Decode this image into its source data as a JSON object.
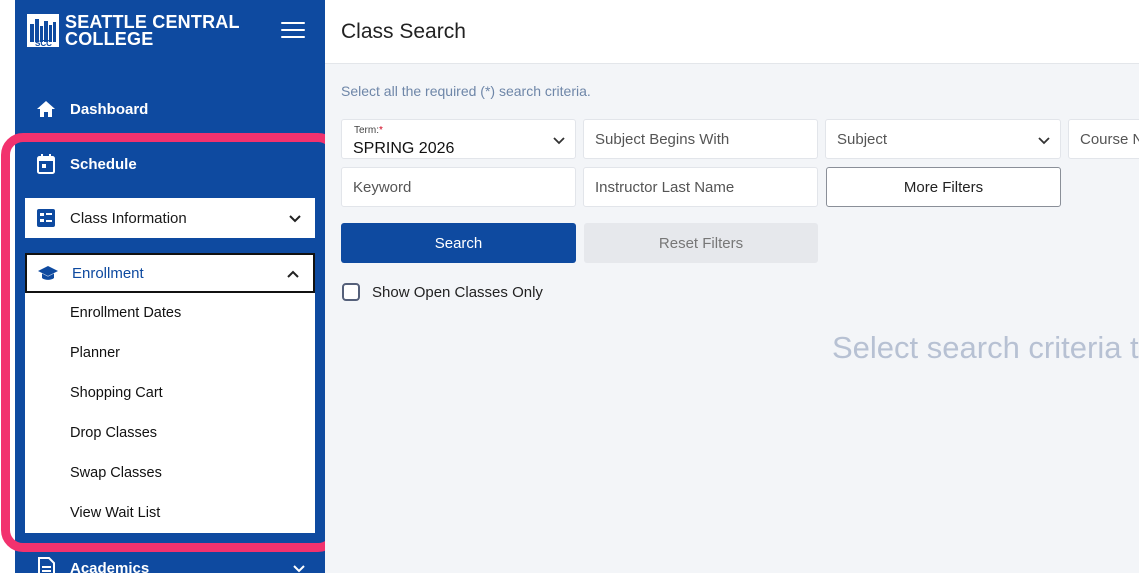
{
  "colors": {
    "brand": "#0e4aa0",
    "highlight": "#f2326e",
    "required": "#d0021b"
  },
  "sidebar": {
    "logo": {
      "line1": "SEATTLE CENTRAL",
      "line2": "COLLEGE",
      "icon": "skyline-logo-icon"
    },
    "toggle_icon": "hamburger-menu-icon",
    "items": [
      {
        "label": "Dashboard",
        "icon": "home-icon"
      },
      {
        "label": "Schedule",
        "icon": "calendar-icon"
      },
      {
        "label": "Academics",
        "icon": "document-icon"
      }
    ],
    "class_info": {
      "label": "Class Information",
      "icon": "list-icon",
      "state": "collapsed"
    },
    "enrollment": {
      "label": "Enrollment",
      "icon": "graduation-cap-icon",
      "state": "expanded",
      "links": [
        "Enrollment Dates",
        "Planner",
        "Shopping Cart",
        "Drop Classes",
        "Swap Classes",
        "View Wait List"
      ]
    }
  },
  "main": {
    "title": "Class Search",
    "hint": "Select all the required (*) search criteria.",
    "term": {
      "label": "Term:",
      "required_mark": "*",
      "value": "SPRING 2026"
    },
    "subject_begins": {
      "placeholder": "Subject Begins With"
    },
    "subject": {
      "placeholder": "Subject"
    },
    "course_number": {
      "placeholder": "Course N"
    },
    "keyword": {
      "placeholder": "Keyword"
    },
    "instructor": {
      "placeholder": "Instructor Last Name"
    },
    "more_filters": "More Filters",
    "search": "Search",
    "reset": "Reset Filters",
    "open_only": {
      "label": "Show Open Classes Only",
      "checked": false
    },
    "empty_message": "Select search criteria to v"
  }
}
